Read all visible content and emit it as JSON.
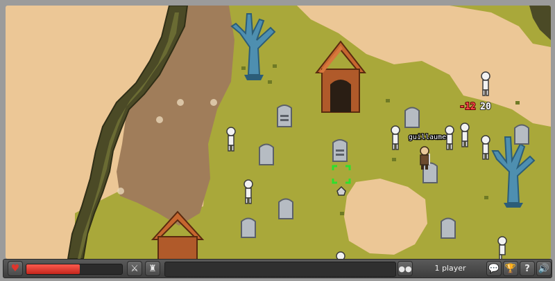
{
  "game": {
    "player": {
      "name": "guillaume",
      "health_fraction": 0.56
    },
    "damage_text": "-12",
    "xp_text": "20"
  },
  "hud": {
    "player_count_label": "1 player",
    "help_label": "?",
    "icons": {
      "health": "heart-icon",
      "weapon": "sword-icon",
      "armor": "armor-icon",
      "players": "players-icon",
      "chat": "chat-icon",
      "achievements": "trophy-icon",
      "help": "help-icon",
      "sound": "speaker-icon"
    }
  },
  "colors": {
    "grass": "#a9a83a",
    "dirt": "#a07d5a",
    "sand": "#ecc796",
    "health": "#e0352c"
  }
}
